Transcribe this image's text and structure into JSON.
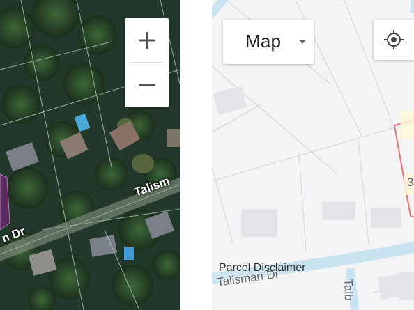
{
  "satellite_view": {
    "zoom_in_label": "+",
    "zoom_out_label": "−",
    "street_label_main": "Talism",
    "street_label_left": "n Dr"
  },
  "map_view": {
    "map_type_label": "Map",
    "locate_icon": "crosshair-icon",
    "disclaimer_link": "Parcel Disclaimer",
    "street_label_bottom": "Talisman Dr",
    "street_label_vertical": "Talb",
    "edge_label": "3"
  },
  "colors": {
    "parcel_outline": "#e57373",
    "road_light": "#c9e4f1",
    "map_background": "#f4f4f6",
    "satellite_parcel_fill": "#5a2a5e"
  }
}
